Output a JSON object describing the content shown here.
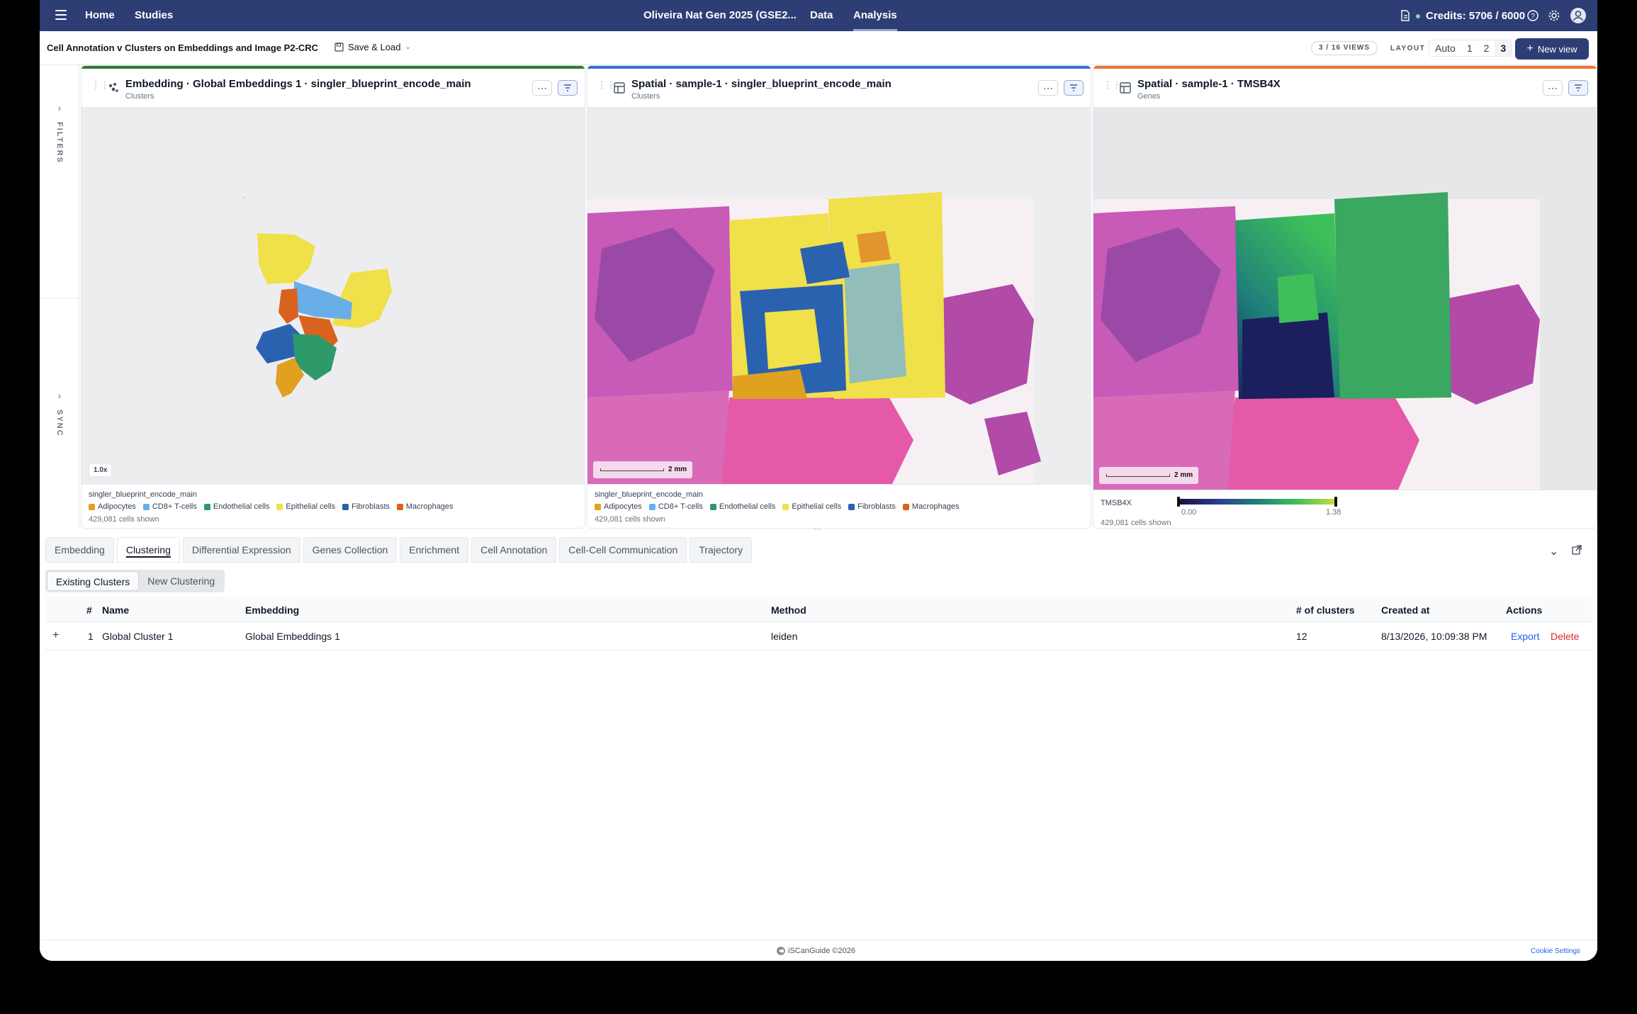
{
  "nav": {
    "home": "Home",
    "studies": "Studies",
    "study_title": "Oliveira Nat Gen 2025 (GSE2...",
    "data": "Data",
    "analysis": "Analysis",
    "credits": "Credits: 5706 / 6000"
  },
  "subheader": {
    "title": "Cell Annotation v Clusters on Embeddings and Image P2-CRC",
    "save_load": "Save & Load",
    "views_badge": "3 / 16 VIEWS",
    "layout_label": "LAYOUT",
    "layout_options": [
      "Auto",
      "1",
      "2",
      "3"
    ],
    "layout_selected": "3",
    "new_view": "New view"
  },
  "siderail": {
    "filters": "FILTERS",
    "sync": "SYNC"
  },
  "panels": [
    {
      "title": "Embedding · Global Embeddings 1 · singler_blueprint_encode_main",
      "subtitle": "Clusters",
      "accent": "#2e7d32",
      "zoom": "1.0x",
      "legend_title": "singler_blueprint_encode_main",
      "cells_shown": "429,081 cells shown"
    },
    {
      "title": "Spatial · sample-1 · singler_blueprint_encode_main",
      "subtitle": "Clusters",
      "accent": "#3b6fd1",
      "scale": "2 mm",
      "legend_title": "singler_blueprint_encode_main",
      "cells_shown": "429,081 cells shown"
    },
    {
      "title": "Spatial · sample-1 · TMSB4X",
      "subtitle": "Genes",
      "accent": "#e8772e",
      "scale": "2 mm",
      "gene": "TMSB4X",
      "range_min": "0.00",
      "range_max": "1.38",
      "cells_shown": "429,081 cells shown"
    }
  ],
  "legend": [
    {
      "label": "Adipocytes",
      "color": "#e0a020"
    },
    {
      "label": "CD8+ T-cells",
      "color": "#6aaee8"
    },
    {
      "label": "Endothelial cells",
      "color": "#2e9a6a"
    },
    {
      "label": "Epithelial cells",
      "color": "#f0e04a"
    },
    {
      "label": "Fibroblasts",
      "color": "#2a62b0"
    },
    {
      "label": "Macrophages",
      "color": "#d9621e"
    }
  ],
  "tabs": [
    "Embedding",
    "Clustering",
    "Differential Expression",
    "Genes Collection",
    "Enrichment",
    "Cell Annotation",
    "Cell-Cell Communication",
    "Trajectory"
  ],
  "active_tab": "Clustering",
  "subtabs": [
    "Existing Clusters",
    "New Clustering"
  ],
  "table": {
    "headers": [
      "#",
      "Name",
      "Embedding",
      "Method",
      "# of clusters",
      "Created at",
      "Actions"
    ],
    "rows": [
      {
        "index": "1",
        "name": "Global Cluster 1",
        "embedding": "Global Embeddings 1",
        "method": "leiden",
        "clusters": "12",
        "created_at": "8/13/2026, 10:09:38 PM",
        "export": "Export",
        "delete": "Delete"
      }
    ]
  },
  "footer": {
    "brand": "iSCanGuide ©2026",
    "cookie": "Cookie Settings"
  }
}
